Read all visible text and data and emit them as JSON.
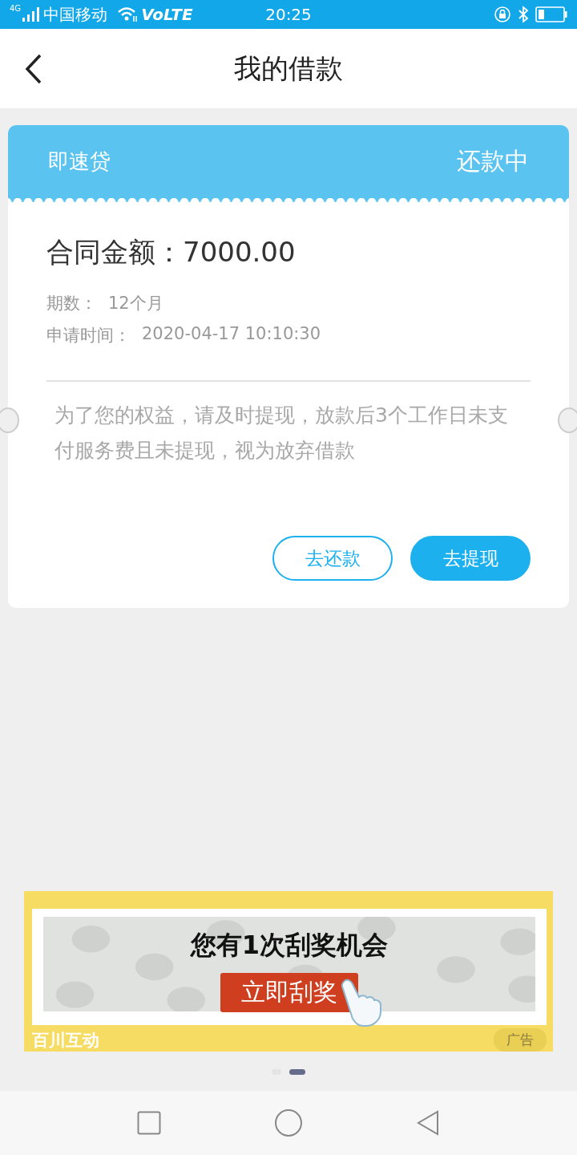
{
  "status_bar": {
    "network_type": "4G",
    "carrier": "中国移动",
    "network": "VoLTE",
    "time": "20:25"
  },
  "header": {
    "title": "我的借款"
  },
  "loan": {
    "product": "即速贷",
    "status": "还款中",
    "amount_label": "合同金额：",
    "amount": "7000.00",
    "details": [
      {
        "label": "期数：",
        "value": "12个月"
      },
      {
        "label": "申请时间：",
        "value": "2020-04-17 10:10:30"
      }
    ],
    "notice": "为了您的权益，请及时提现，放款后3个工作日未支付服务费且未提现，视为放弃借款",
    "buttons": [
      {
        "label": "去还款",
        "kind": "outline"
      },
      {
        "label": "去提现",
        "kind": "filled"
      }
    ]
  },
  "ad": {
    "headline": "您有1次刮奖机会",
    "button": "立即刮奖",
    "brand": "百川互动",
    "tag": "广告"
  },
  "pager": [
    {
      "selected": false
    },
    {
      "selected": true
    }
  ]
}
